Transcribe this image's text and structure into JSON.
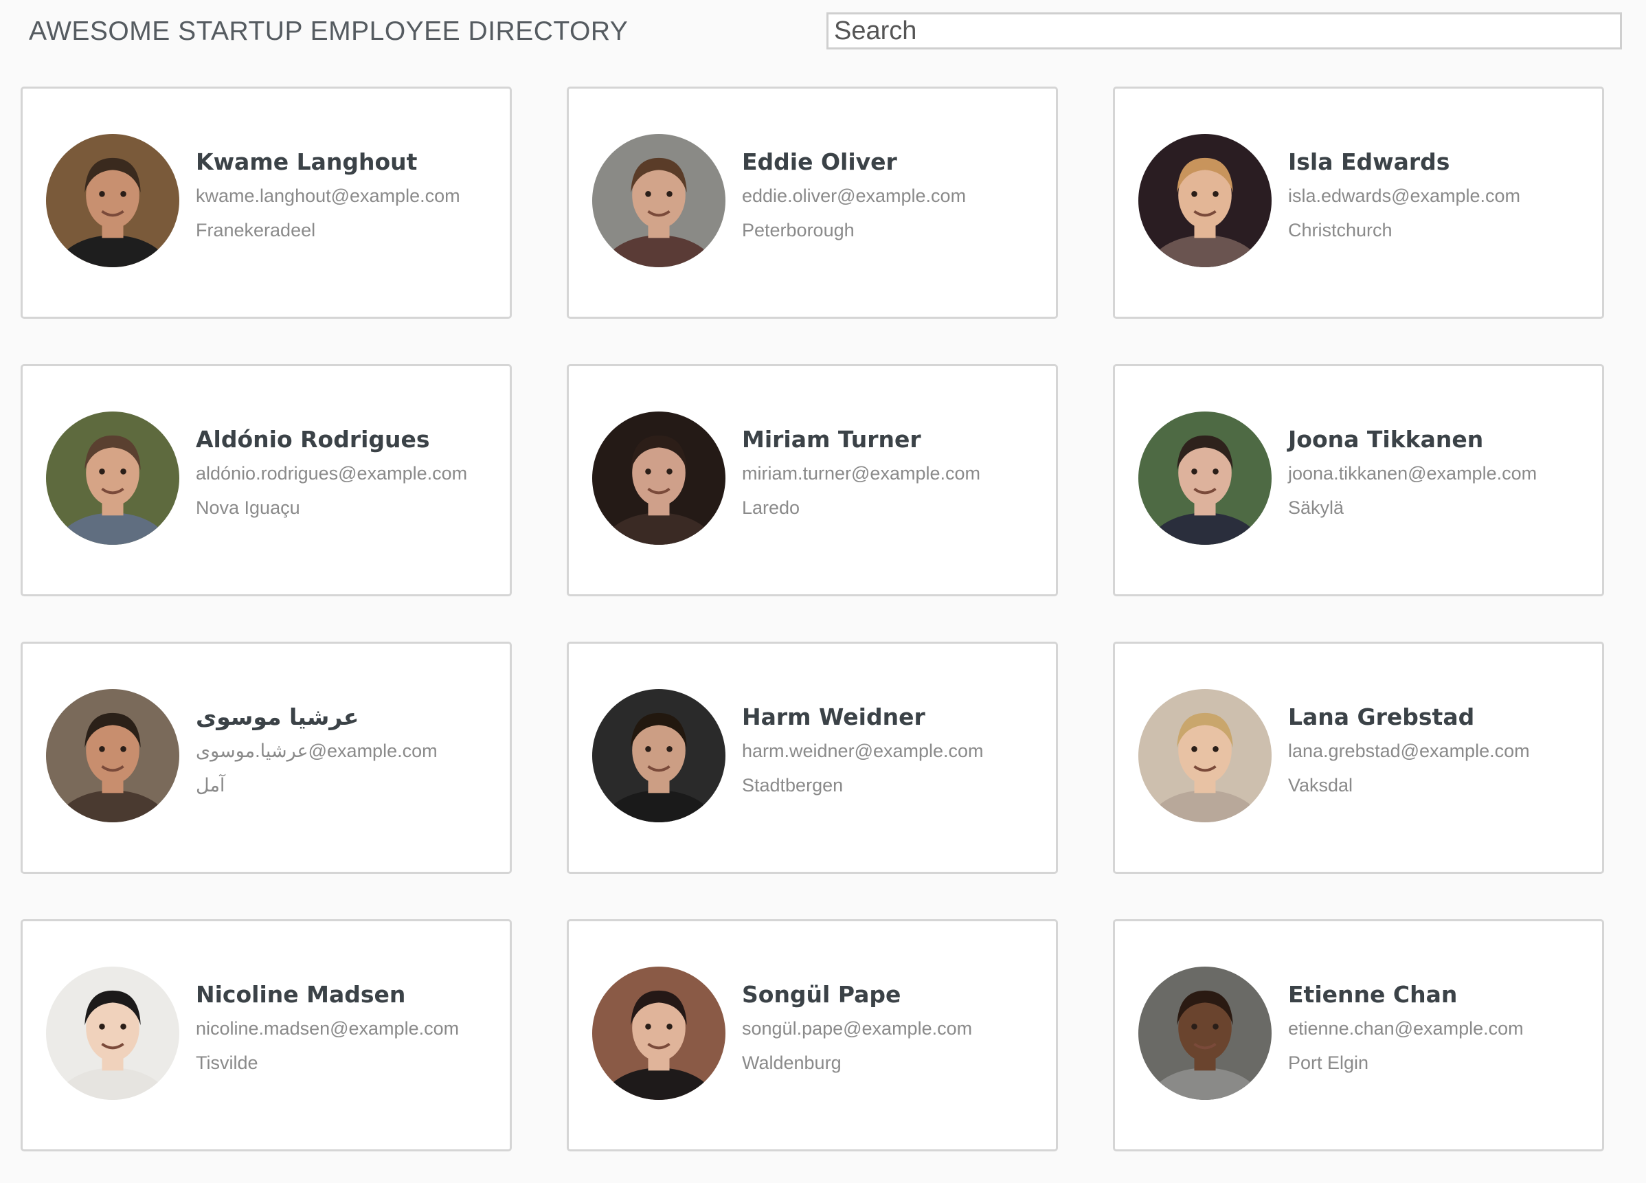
{
  "header": {
    "title": "AWESOME STARTUP EMPLOYEE DIRECTORY",
    "search_placeholder": "Search"
  },
  "colors": {
    "background": "#fafafa",
    "card_border": "#d5d5d5",
    "name_text": "#3b4247",
    "secondary_text": "#8a8a8a"
  },
  "employees": [
    {
      "name": "Kwame Langhout",
      "email": "kwame.langhout@example.com",
      "location": "Franekeradeel",
      "avatar": {
        "bg": "#7a5a3a",
        "skin": "#c89070",
        "hair": "#3a2a1e",
        "shirt": "#1e1e1e"
      }
    },
    {
      "name": "Eddie Oliver",
      "email": "eddie.oliver@example.com",
      "location": "Peterborough",
      "avatar": {
        "bg": "#8a8a86",
        "skin": "#d2a48a",
        "hair": "#5a3c28",
        "shirt": "#5a3b36"
      }
    },
    {
      "name": "Isla Edwards",
      "email": "isla.edwards@example.com",
      "location": "Christchurch",
      "avatar": {
        "bg": "#2a1d22",
        "skin": "#e3b696",
        "hair": "#c8945c",
        "shirt": "#6a5450"
      }
    },
    {
      "name": "Aldónio Rodrigues",
      "email": "aldónio.rodrigues@example.com",
      "location": "Nova Iguaçu",
      "avatar": {
        "bg": "#5e6a3e",
        "skin": "#d6a486",
        "hair": "#5a4030",
        "shirt": "#606e80"
      }
    },
    {
      "name": "Miriam Turner",
      "email": "miriam.turner@example.com",
      "location": "Laredo",
      "avatar": {
        "bg": "#241a16",
        "skin": "#cfa08a",
        "hair": "#2c1e18",
        "shirt": "#3a2a24"
      }
    },
    {
      "name": "Joona Tikkanen",
      "email": "joona.tikkanen@example.com",
      "location": "Säkylä",
      "avatar": {
        "bg": "#4e6a44",
        "skin": "#ddb29c",
        "hair": "#2e221c",
        "shirt": "#2a2e3c"
      }
    },
    {
      "name": "عرشيا موسوی",
      "email": "عرشيا.موسوی@example.com",
      "location": "آمل",
      "avatar": {
        "bg": "#7a6a5a",
        "skin": "#c88e6e",
        "hair": "#2a2018",
        "shirt": "#4a3a30"
      }
    },
    {
      "name": "Harm Weidner",
      "email": "harm.weidner@example.com",
      "location": "Stadtbergen",
      "avatar": {
        "bg": "#2a2a2a",
        "skin": "#cc9e84",
        "hair": "#22180f",
        "shirt": "#1a1a1a"
      }
    },
    {
      "name": "Lana Grebstad",
      "email": "lana.grebstad@example.com",
      "location": "Vaksdal",
      "avatar": {
        "bg": "#cdbfae",
        "skin": "#e8c2a4",
        "hair": "#c9a66c",
        "shirt": "#b8a89a"
      }
    },
    {
      "name": "Nicoline Madsen",
      "email": "nicoline.madsen@example.com",
      "location": "Tisvilde",
      "avatar": {
        "bg": "#ecebe8",
        "skin": "#f0d2bc",
        "hair": "#1c1a1a",
        "shirt": "#e6e4e0"
      }
    },
    {
      "name": "Songül Pape",
      "email": "songül.pape@example.com",
      "location": "Waldenburg",
      "avatar": {
        "bg": "#8a5a46",
        "skin": "#e0b49a",
        "hair": "#241816",
        "shirt": "#1e1a1a"
      }
    },
    {
      "name": "Etienne Chan",
      "email": "etienne.chan@example.com",
      "location": "Port Elgin",
      "avatar": {
        "bg": "#6a6a66",
        "skin": "#6a442e",
        "hair": "#2a1a12",
        "shirt": "#8a8a88"
      }
    }
  ]
}
